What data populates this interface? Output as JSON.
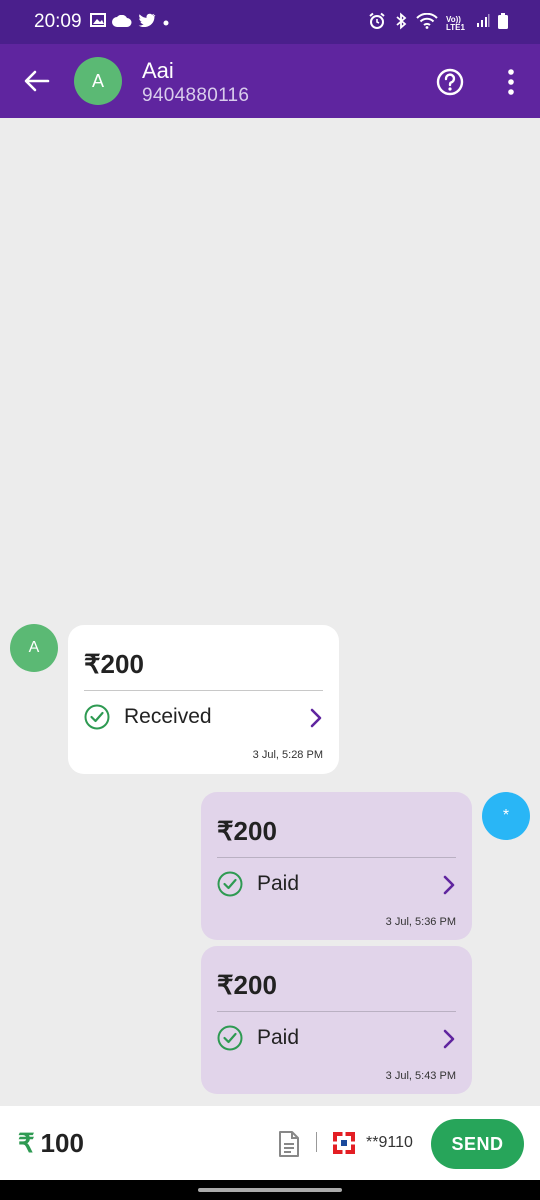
{
  "status_bar": {
    "time": "20:09",
    "left_icons": [
      "gallery-icon",
      "cloud-icon",
      "twitter-icon",
      "dot-icon"
    ],
    "right_icons": [
      "alarm-icon",
      "bluetooth-icon",
      "wifi-icon",
      "signal-icon",
      "battery-icon"
    ],
    "network_label": "Vo)) LTE1"
  },
  "header": {
    "avatar_letter": "A",
    "contact_name": "Aai",
    "contact_phone": "9404880116",
    "back_icon": "arrow-left-icon",
    "help_icon": "help-circle-icon",
    "more_icon": "more-vertical-icon"
  },
  "messages": [
    {
      "direction": "received",
      "amount": "₹200",
      "status": "Received",
      "timestamp": "3 Jul, 5:28 PM",
      "avatar_letter": "A"
    },
    {
      "direction": "sent",
      "amount": "₹200",
      "status": "Paid",
      "timestamp": "3 Jul, 5:36 PM",
      "avatar_letter": "*"
    },
    {
      "direction": "sent",
      "amount": "₹200",
      "status": "Paid",
      "timestamp": "3 Jul, 5:43 PM"
    }
  ],
  "composer": {
    "currency_symbol": "₹",
    "amount_value": "100",
    "account_mask": "**9110",
    "send_label": "SEND"
  },
  "colors": {
    "status_bar": "#4a1f8c",
    "app_bar": "#5f259f",
    "received_avatar": "#5bb974",
    "sent_avatar": "#29b6f6",
    "sent_bubble": "#e1d4ea",
    "send_button": "#27a55a",
    "chevron": "#5f259f"
  }
}
